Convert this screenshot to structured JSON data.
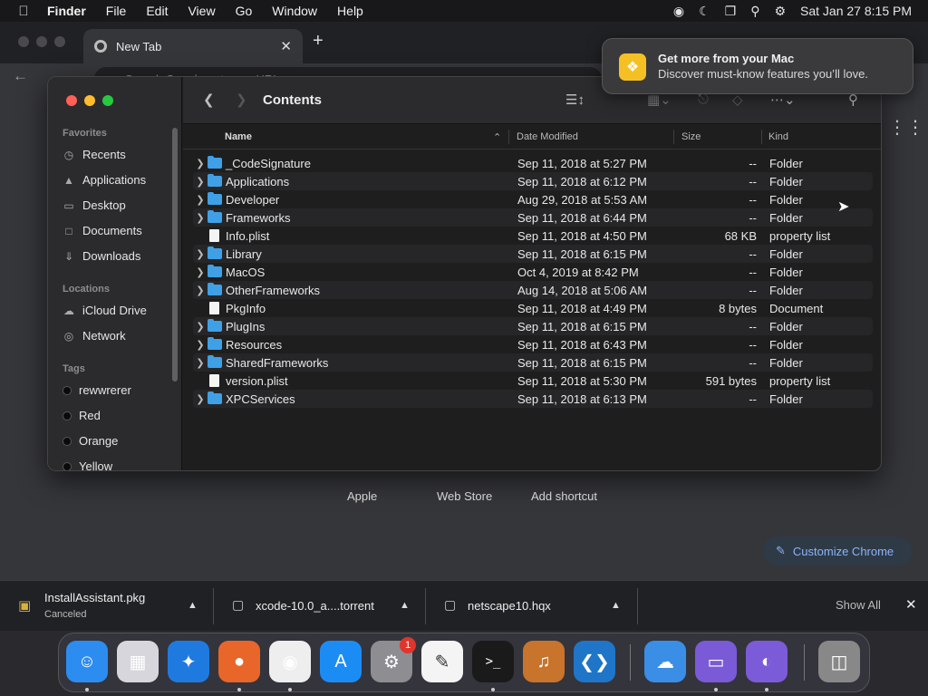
{
  "menubar": {
    "app": "Finder",
    "items": [
      "File",
      "Edit",
      "View",
      "Go",
      "Window",
      "Help"
    ],
    "datetime": "Sat Jan 27  8:15 PM"
  },
  "chrome": {
    "tab_title": "New Tab",
    "omnibox_placeholder": "Search Google or type a URL",
    "shortcuts": [
      "Apple",
      "Web Store",
      "Add shortcut"
    ],
    "customize_label": "Customize Chrome"
  },
  "downloads": {
    "items": [
      {
        "name": "InstallAssistant.pkg",
        "status": "Canceled"
      },
      {
        "name": "xcode-10.0_a....torrent",
        "status": ""
      },
      {
        "name": "netscape10.hqx",
        "status": ""
      }
    ],
    "show_all": "Show All"
  },
  "notification": {
    "title": "Get more from your Mac",
    "body": "Discover must-know features you’ll love."
  },
  "finder": {
    "title": "Contents",
    "sidebar": {
      "favorites_header": "Favorites",
      "favorites": [
        {
          "label": "Recents",
          "icon": "clock-icon"
        },
        {
          "label": "Applications",
          "icon": "applications-icon"
        },
        {
          "label": "Desktop",
          "icon": "desktop-icon"
        },
        {
          "label": "Documents",
          "icon": "document-icon"
        },
        {
          "label": "Downloads",
          "icon": "downloads-icon"
        }
      ],
      "locations_header": "Locations",
      "locations": [
        {
          "label": "iCloud Drive",
          "icon": "cloud-icon"
        },
        {
          "label": "Network",
          "icon": "network-icon"
        }
      ],
      "tags_header": "Tags",
      "tags": [
        "rewwrerer",
        "Red",
        "Orange",
        "Yellow"
      ]
    },
    "columns": {
      "name": "Name",
      "date": "Date Modified",
      "size": "Size",
      "kind": "Kind"
    },
    "rows": [
      {
        "name": "_CodeSignature",
        "date": "Sep 11, 2018 at 5:27 PM",
        "size": "--",
        "kind": "Folder",
        "type": "folder"
      },
      {
        "name": "Applications",
        "date": "Sep 11, 2018 at 6:12 PM",
        "size": "--",
        "kind": "Folder",
        "type": "folder"
      },
      {
        "name": "Developer",
        "date": "Aug 29, 2018 at 5:53 AM",
        "size": "--",
        "kind": "Folder",
        "type": "folder"
      },
      {
        "name": "Frameworks",
        "date": "Sep 11, 2018 at 6:44 PM",
        "size": "--",
        "kind": "Folder",
        "type": "folder"
      },
      {
        "name": "Info.plist",
        "date": "Sep 11, 2018 at 4:50 PM",
        "size": "68 KB",
        "kind": "property list",
        "type": "file"
      },
      {
        "name": "Library",
        "date": "Sep 11, 2018 at 6:15 PM",
        "size": "--",
        "kind": "Folder",
        "type": "folder"
      },
      {
        "name": "MacOS",
        "date": "Oct 4, 2019 at 8:42 PM",
        "size": "--",
        "kind": "Folder",
        "type": "folder"
      },
      {
        "name": "OtherFrameworks",
        "date": "Aug 14, 2018 at 5:06 AM",
        "size": "--",
        "kind": "Folder",
        "type": "folder"
      },
      {
        "name": "PkgInfo",
        "date": "Sep 11, 2018 at 4:49 PM",
        "size": "8 bytes",
        "kind": "Document",
        "type": "file"
      },
      {
        "name": "PlugIns",
        "date": "Sep 11, 2018 at 6:15 PM",
        "size": "--",
        "kind": "Folder",
        "type": "folder"
      },
      {
        "name": "Resources",
        "date": "Sep 11, 2018 at 6:43 PM",
        "size": "--",
        "kind": "Folder",
        "type": "folder"
      },
      {
        "name": "SharedFrameworks",
        "date": "Sep 11, 2018 at 6:15 PM",
        "size": "--",
        "kind": "Folder",
        "type": "folder"
      },
      {
        "name": "version.plist",
        "date": "Sep 11, 2018 at 5:30 PM",
        "size": "591 bytes",
        "kind": "property list",
        "type": "file"
      },
      {
        "name": "XPCServices",
        "date": "Sep 11, 2018 at 6:13 PM",
        "size": "--",
        "kind": "Folder",
        "type": "folder"
      }
    ]
  },
  "dock": {
    "apps": [
      {
        "name": "finder-app",
        "color": "#2d8cf0"
      },
      {
        "name": "launchpad-app",
        "color": "#d6d6dc"
      },
      {
        "name": "safari-app",
        "color": "#1f7ae0"
      },
      {
        "name": "firefox-app",
        "color": "#e8662a"
      },
      {
        "name": "chrome-app",
        "color": "#eeeeee"
      },
      {
        "name": "app-store-app",
        "color": "#1c8cf5"
      },
      {
        "name": "system-settings-app",
        "color": "#8d8d92",
        "badge": "1"
      },
      {
        "name": "textedit-app",
        "color": "#f4f4f4"
      },
      {
        "name": "terminal-app",
        "color": "#1a1a1a"
      },
      {
        "name": "garageband-app",
        "color": "#c8742c"
      },
      {
        "name": "vscode-app",
        "color": "#1f75c8"
      },
      {
        "name": "weather-app",
        "color": "#3a8ee6"
      },
      {
        "name": "xcode-utility-app",
        "color": "#7a5ad6"
      },
      {
        "name": "bittorrent-app",
        "color": "#7c5bd8"
      },
      {
        "name": "trash-app",
        "color": "#888888"
      }
    ]
  }
}
